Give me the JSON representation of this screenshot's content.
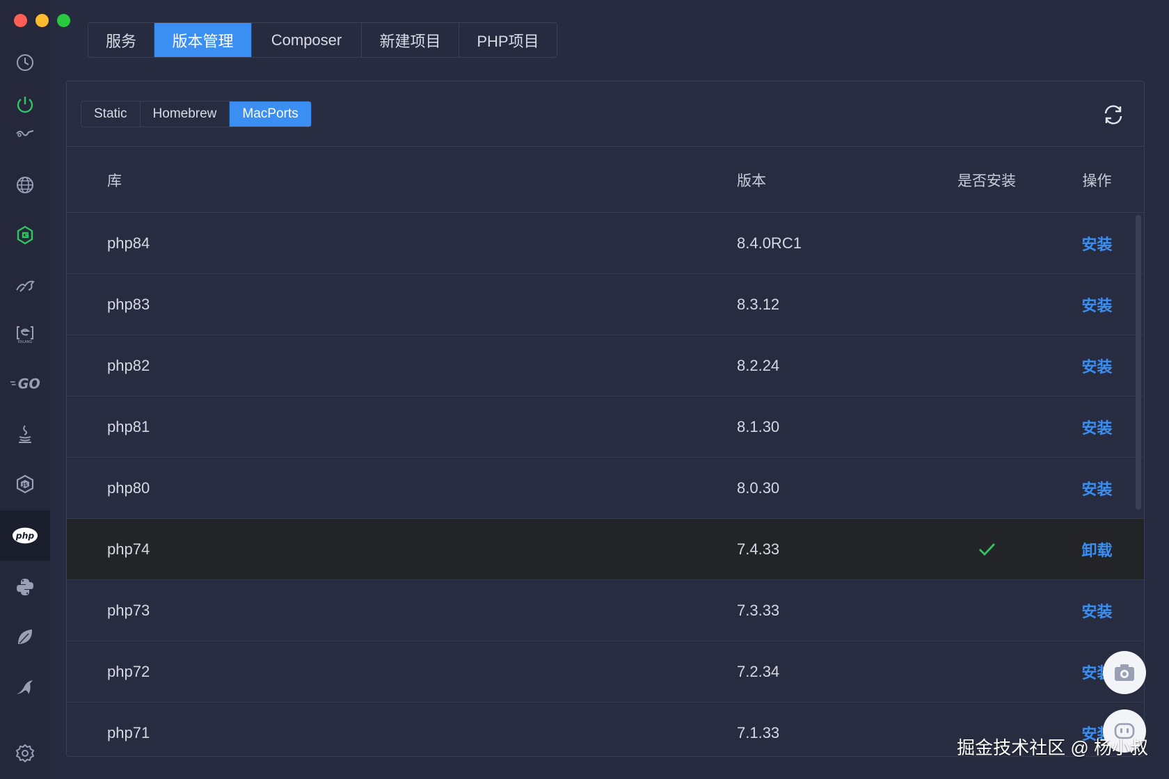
{
  "sidebar": {
    "items": [
      {
        "icon": "clock-icon"
      },
      {
        "icon": "power-icon",
        "color": "#30c463"
      },
      {
        "icon": "handshake-icon"
      },
      {
        "icon": "globe-icon"
      },
      {
        "icon": "gitea-icon",
        "color": "#30c463"
      },
      {
        "icon": "tomcat-icon"
      },
      {
        "icon": "erlang-icon"
      },
      {
        "icon": "go-icon"
      },
      {
        "icon": "java-icon"
      },
      {
        "icon": "nodejs-icon"
      },
      {
        "icon": "php-icon"
      },
      {
        "icon": "python-icon"
      },
      {
        "icon": "leaf-icon"
      },
      {
        "icon": "bird-icon"
      },
      {
        "icon": "settings-icon"
      }
    ]
  },
  "top_tabs": [
    {
      "label": "服务"
    },
    {
      "label": "版本管理",
      "active": true
    },
    {
      "label": "Composer"
    },
    {
      "label": "新建项目"
    },
    {
      "label": "PHP项目"
    }
  ],
  "sub_tabs": [
    {
      "label": "Static"
    },
    {
      "label": "Homebrew"
    },
    {
      "label": "MacPorts",
      "active": true
    }
  ],
  "table": {
    "headers": {
      "lib": "库",
      "version": "版本",
      "installed": "是否安装",
      "action": "操作"
    },
    "rows": [
      {
        "lib": "php84",
        "version": "8.4.0RC1",
        "installed": false,
        "action": "安装"
      },
      {
        "lib": "php83",
        "version": "8.3.12",
        "installed": false,
        "action": "安装"
      },
      {
        "lib": "php82",
        "version": "8.2.24",
        "installed": false,
        "action": "安装"
      },
      {
        "lib": "php81",
        "version": "8.1.30",
        "installed": false,
        "action": "安装"
      },
      {
        "lib": "php80",
        "version": "8.0.30",
        "installed": false,
        "action": "安装"
      },
      {
        "lib": "php74",
        "version": "7.4.33",
        "installed": true,
        "action": "卸载"
      },
      {
        "lib": "php73",
        "version": "7.3.33",
        "installed": false,
        "action": "安装"
      },
      {
        "lib": "php72",
        "version": "7.2.34",
        "installed": false,
        "action": "安装"
      },
      {
        "lib": "php71",
        "version": "7.1.33",
        "installed": false,
        "action": "安装"
      }
    ]
  },
  "watermark": "掘金技术社区 @ 杨小叔",
  "colors": {
    "accent": "#3b8ff2",
    "check": "#30c463"
  }
}
